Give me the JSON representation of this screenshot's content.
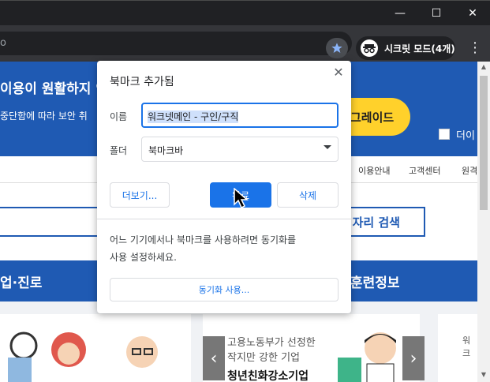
{
  "window": {
    "minimize": "—",
    "maximize": "☐",
    "close": "✕"
  },
  "toolbar": {
    "url_fragment": "o",
    "incognito_label": "시크릿 모드(4개)"
  },
  "page": {
    "banner_line1": "이용이 원활하지 인",
    "banner_line2": "중단함에 따라 보안 취",
    "upgrade_button": "그레이드",
    "checkbox_label": "더이",
    "nav_items": [
      "이용안내",
      "고객센터",
      "원격"
    ],
    "search_button": "자리 검색",
    "section_left": "업·진로",
    "section_right": "훈련정보",
    "card_line1": "고용노동부가 선정한",
    "card_line2": "작지만 강한 기업",
    "card_line3": "청년친화강소기업",
    "card_right": "워크"
  },
  "bookmark_dialog": {
    "title": "북마크 추가됨",
    "name_label": "이름",
    "name_value": "워크넷메인 - 구인/구직",
    "folder_label": "폴더",
    "folder_value": "북마크바",
    "more_button": "더보기...",
    "done_button": "완료",
    "remove_button": "삭제",
    "sync_text_line1": "어느 기기에서나 북마크를 사용하려면 동기화를",
    "sync_text_line2": "사용 설정하세요.",
    "sync_button": "동기화 사용..."
  },
  "colors": {
    "chrome_dark": "#202124",
    "toolbar": "#35363a",
    "accent_blue": "#1a73e8",
    "site_blue": "#1f5ab3",
    "upgrade_yellow": "#ffd12b"
  }
}
